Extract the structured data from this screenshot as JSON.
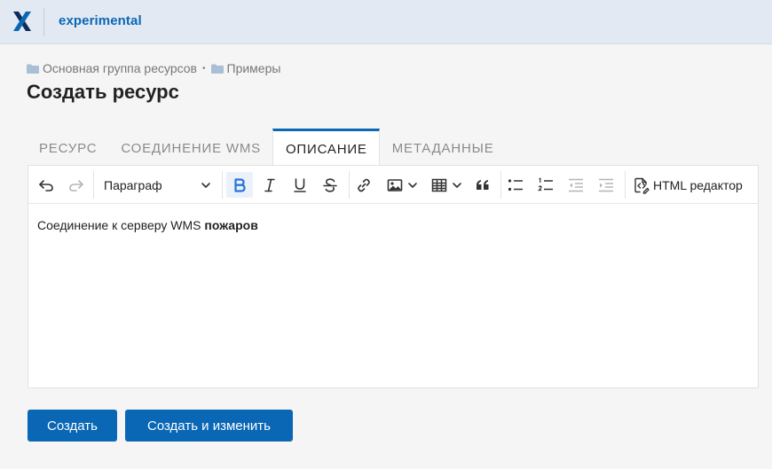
{
  "header": {
    "app_title": "experimental"
  },
  "breadcrumb": {
    "items": [
      "Основная группа ресурсов",
      "Примеры"
    ],
    "separator": "•"
  },
  "page": {
    "title": "Создать ресурс"
  },
  "tabs": [
    {
      "label": "РЕСУРС",
      "active": false
    },
    {
      "label": "СОЕДИНЕНИЕ WMS",
      "active": false
    },
    {
      "label": "ОПИСАНИЕ",
      "active": true
    },
    {
      "label": "МЕТАДАННЫЕ",
      "active": false
    }
  ],
  "toolbar": {
    "paragraph_select": "Параграф",
    "html_editor_label": "HTML редактор",
    "icons": [
      "undo-icon",
      "redo-icon",
      "bold-icon",
      "italic-icon",
      "underline-icon",
      "strikethrough-icon",
      "link-icon",
      "image-icon",
      "table-icon",
      "blockquote-icon",
      "bulleted-list-icon",
      "numbered-list-icon",
      "outdent-icon",
      "indent-icon",
      "html-source-icon"
    ],
    "bold_active": true
  },
  "editor": {
    "text_plain": "Соединение к серверу WMS",
    "text_bold": "пожаров"
  },
  "buttons": {
    "create": "Создать",
    "create_and_edit": "Создать и изменить"
  },
  "colors": {
    "accent": "#0a67b5",
    "header_bg": "#e2e9f3",
    "page_bg": "#f5f5f5"
  }
}
